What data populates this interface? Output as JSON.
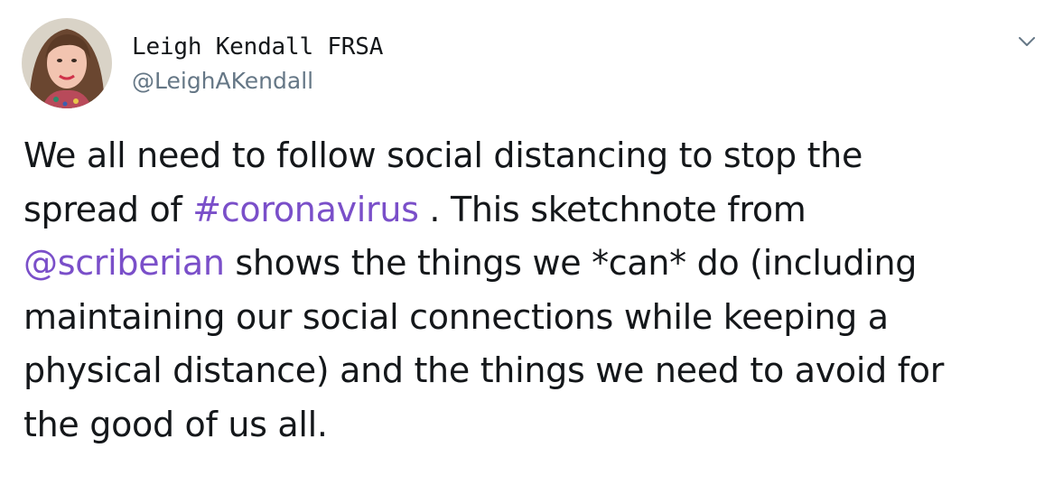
{
  "author": {
    "display_name": "Leigh Kendall FRSA",
    "handle": "@LeighAKendall"
  },
  "menu_icon": "chevron-down-icon",
  "tweet": {
    "line1": "We all need to follow social distancing to stop the",
    "line2_pre": "spread of ",
    "hashtag": "#coronavirus",
    "line2_post": " . This sketchnote from",
    "mention": "@scriberian",
    "line3_post": " shows the things we *can* do (including",
    "line4": "maintaining our social connections while keeping a",
    "line5": "physical distance) and the things we need to avoid for",
    "line6": "the good of us all."
  },
  "colors": {
    "link": "#7a4fc9",
    "text": "#14171a",
    "secondary": "#657786"
  }
}
